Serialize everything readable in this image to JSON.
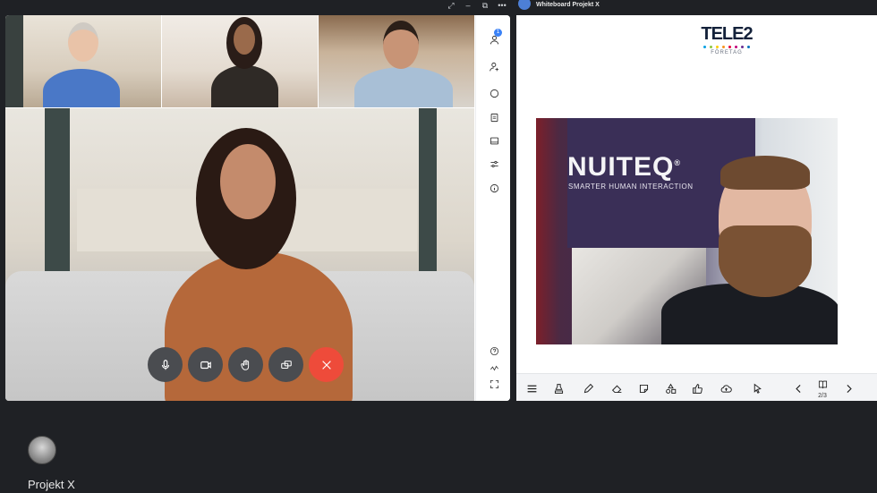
{
  "window": {
    "controls": [
      "expand-icon",
      "minimize-icon",
      "popout-icon",
      "more-icon"
    ],
    "whiteboard_title": "Whiteboard Projekt X"
  },
  "call": {
    "participants_badge": "1",
    "controls": [
      "microphone-icon",
      "camera-icon",
      "raise-hand-icon",
      "share-screen-icon",
      "end-call-icon"
    ],
    "end_call_color": "#ee4b3a",
    "side_rail": [
      "participants-icon",
      "profile-icon",
      "chat-icon",
      "notes-icon",
      "layout-icon",
      "settings-sliders-icon",
      "info-icon",
      "help-icon",
      "activity-icon",
      "fullscreen-icon"
    ]
  },
  "whiteboard": {
    "logo_text": "TELE2",
    "logo_sub": "FÖRETAG",
    "logo_dot_colors": [
      "#00a0e3",
      "#8dc63f",
      "#ffcc00",
      "#f7941d",
      "#e4003a",
      "#c1007a",
      "#6a2c91",
      "#0072bc"
    ],
    "photo_banner_title": "NUITEQ",
    "photo_banner_registered": "®",
    "photo_banner_subtitle": "SMARTER HUMAN INTERACTION",
    "toolbar": [
      "menu-icon",
      "stamp-icon",
      "pen-icon",
      "eraser-icon",
      "sticky-note-icon",
      "shapes-icon",
      "thumbs-up-icon",
      "cloud-upload-icon",
      "pointer-icon"
    ],
    "page_indicator": "2/3"
  },
  "footer": {
    "room_name": "Projekt X"
  }
}
